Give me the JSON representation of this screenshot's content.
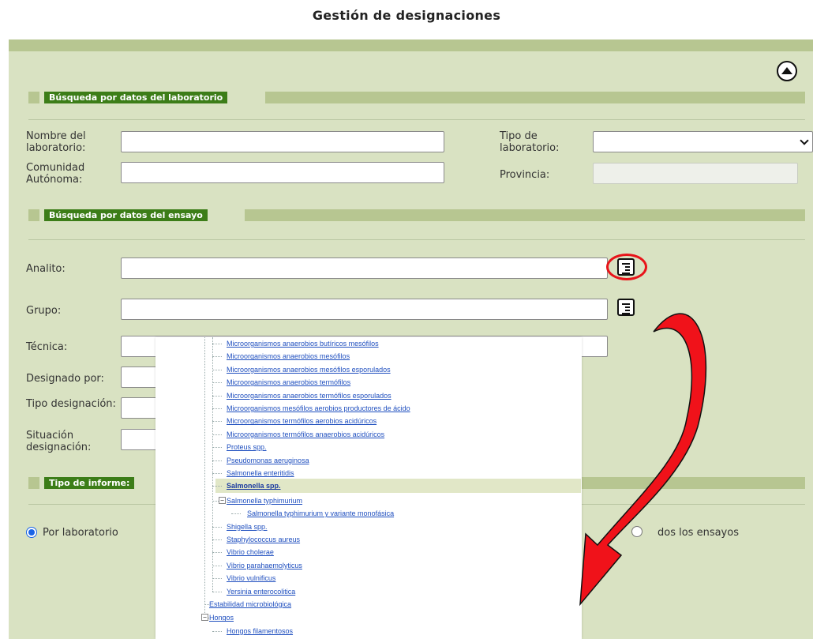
{
  "page": {
    "title": "Gestión de designaciones"
  },
  "lab_section": {
    "title": "Búsqueda por datos del laboratorio",
    "nombre_label": "Nombre del laboratorio:",
    "tipo_label": "Tipo de laboratorio:",
    "comunidad_label": "Comunidad Autónoma:",
    "provincia_label": "Provincia:",
    "nombre_value": "",
    "comunidad_value": "",
    "tipo_value": "",
    "provincia_value": ""
  },
  "ensayo_section": {
    "title": "Búsqueda por datos del ensayo",
    "analito_label": "Analito:",
    "grupo_label": "Grupo:",
    "tecnica_label": "Técnica:",
    "designado_label": "Designado por:",
    "tipo_designacion_label": "Tipo designación:",
    "situacion_label": "Situación designación:",
    "analito_value": "",
    "grupo_value": "",
    "tecnica_value": ""
  },
  "informe_section": {
    "title": "Tipo de informe:",
    "option_laboratorio": "Por laboratorio",
    "option_todos": "dos los ensayos",
    "selected": "Por laboratorio"
  },
  "tree": {
    "selected": "Salmonella spp.",
    "items": [
      "Microorganismos anaerobios butíricos mesófilos",
      "Microorganismos anaerobios mesófilos",
      "Microorganismos anaerobios mesófilos esporulados",
      "Microorganismos anaerobios termófilos",
      "Microorganismos anaerobios termófilos esporulados",
      "Microorganismos mesófilos aerobios productores de ácido",
      "Microorganismos termófilos aerobios acidúricos",
      "Microorganismos termófilos anaerobios acidúricos",
      "Proteus spp.",
      "Pseudomonas aeruginosa",
      "Salmonella enteritidis",
      "Salmonella spp.",
      "Salmonella typhimurium",
      "Salmonella typhimurium y variante monofásica",
      "Shigella spp.",
      "Staphylococcus aureus",
      "Vibrio cholerae",
      "Vibrio parahaemolyticus",
      "Vibrio vulnificus",
      "Yersinia enterocolitica",
      "Estabilidad microbiológica",
      "Hongos",
      "Hongos filamentosos"
    ]
  },
  "icons": {
    "tree_picker": "tree-list-icon",
    "collapse": "collapse-up-icon",
    "annotation_arrow": "red-curved-arrow",
    "highlight": "red-ellipse-highlight"
  },
  "colors": {
    "panel": "#d9e2c2",
    "section_header": "#3c7d18",
    "bar": "#b7c691",
    "link": "#1f4fbf",
    "annotation": "#e8141a",
    "radio": "#1a64e6"
  }
}
